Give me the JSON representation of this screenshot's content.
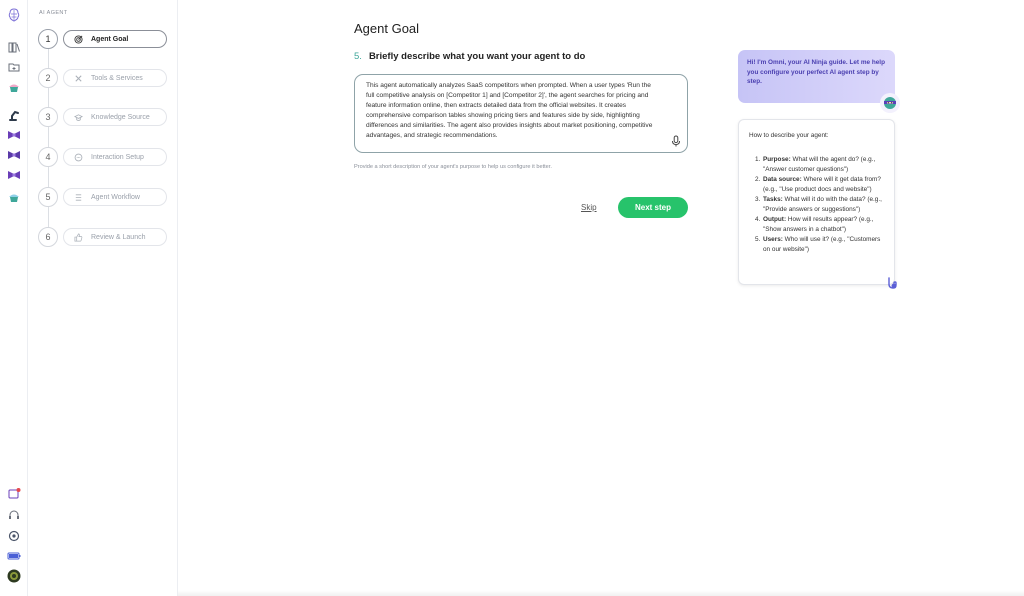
{
  "sidebar": {
    "section_label": "AI AGENT",
    "steps": [
      {
        "num": "1",
        "label": "Agent Goal",
        "icon": "target-icon",
        "active": true
      },
      {
        "num": "2",
        "label": "Tools & Services",
        "icon": "tools-icon",
        "active": false
      },
      {
        "num": "3",
        "label": "Knowledge Source",
        "icon": "graduation-cap-icon",
        "active": false
      },
      {
        "num": "4",
        "label": "Interaction Setup",
        "icon": "chat-icon",
        "active": false
      },
      {
        "num": "5",
        "label": "Agent Workflow",
        "icon": "workflow-icon",
        "active": false
      },
      {
        "num": "6",
        "label": "Review & Launch",
        "icon": "thumbs-up-icon",
        "active": false
      }
    ]
  },
  "rail": {
    "top_icons": [
      "brain-logo-icon",
      "library-icon",
      "folder-icon",
      "cupcake-icon",
      "robot-arm-icon",
      "ribbon-icon",
      "ribbon-icon",
      "ribbon-icon",
      "cupcake-icon"
    ],
    "bottom_icons": [
      "announcement-icon",
      "headset-icon",
      "settings-icon",
      "battery-icon",
      "user-avatar-icon"
    ]
  },
  "main": {
    "title": "Agent Goal",
    "question_num": "5.",
    "question": "Briefly describe what you want your agent to do",
    "goal_text": "This agent automatically analyzes SaaS competitors when prompted. When a user types 'Run the full competitive analysis on [Competitor 1] and [Competitor 2]', the agent searches for pricing and feature information online, then extracts detailed data from the official websites. It creates comprehensive comparison tables showing pricing tiers and features side by side, highlighting differences and similarities. The agent also provides insights about market positioning, competitive advantages, and strategic recommendations.",
    "helper": "Provide a short description of your agent's purpose to help us configure it better.",
    "skip_label": "Skip",
    "next_label": "Next step"
  },
  "guide": {
    "bubble": "Hi! I'm Omni, your AI Ninja guide. Let me help you configure your perfect AI agent step by step.",
    "card_title": "How to describe your agent:",
    "items": [
      {
        "num": "1.",
        "key": "Purpose:",
        "text": " What will the agent do? (e.g., \"Answer customer questions\")"
      },
      {
        "num": "2.",
        "key": "Data source:",
        "text": " Where will it get data from? (e.g., \"Use product docs and website\")"
      },
      {
        "num": "3.",
        "key": "Tasks:",
        "text": " What will it do with the data? (e.g., \"Provide answers or suggestions\")"
      },
      {
        "num": "4.",
        "key": "Output:",
        "text": " How will results appear? (e.g., \"Show answers in a chatbot\")"
      },
      {
        "num": "5.",
        "key": "Users:",
        "text": " Who will use it? (e.g., \"Customers on our website\")"
      }
    ]
  },
  "colors": {
    "accent_green": "#27c36b",
    "bubble_purple": "#c6c4f6",
    "bubble_text": "#4a3fb0"
  }
}
